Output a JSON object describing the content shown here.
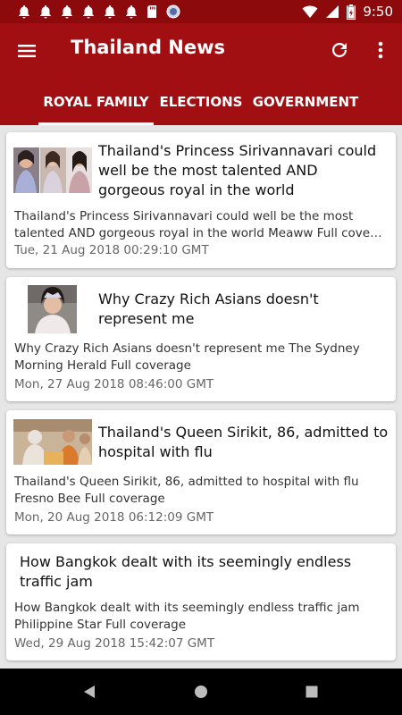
{
  "status_bar": {
    "time": "9:50",
    "notification_icons": [
      "bell-icon",
      "bell-icon",
      "bell-icon",
      "bell-icon",
      "bell-icon",
      "bell-icon",
      "sd-card-icon",
      "circle-icon"
    ]
  },
  "app_bar": {
    "title": "Thailand News",
    "background_color": "#a20f13"
  },
  "tabs": [
    {
      "label": "ROYAL FAMILY",
      "selected": true
    },
    {
      "label": "ELECTIONS",
      "selected": false
    },
    {
      "label": "GOVERNMENT",
      "selected": false
    }
  ],
  "articles": [
    {
      "headline": "Thailand's Princess Sirivannavari could well be the most talented AND gorgeous royal in the world",
      "summary_line1": "Thailand's Princess Sirivannavari could well be the most",
      "summary_line2": "talented AND gorgeous royal in the world  Meaww  Full cove…",
      "date": "Tue, 21 Aug 2018 00:29:10 GMT",
      "has_image": true
    },
    {
      "headline": "Why Crazy Rich Asians doesn't represent me",
      "summary_line1": "Why Crazy Rich Asians doesn't represent me  The Sydney",
      "summary_line2": "Morning Herald  Full coverage",
      "date": "Mon, 27 Aug 2018 08:46:00 GMT",
      "has_image": true
    },
    {
      "headline": "Thailand's Queen Sirikit, 86, admitted to hospital with flu",
      "summary_line1": "Thailand's Queen Sirikit, 86, admitted to hospital with flu",
      "summary_line2": "Fresno Bee  Full coverage",
      "date": "Mon, 20 Aug 2018 06:12:09 GMT",
      "has_image": true
    },
    {
      "headline": "How Bangkok dealt with its seemingly endless traffic jam",
      "summary_line1": "How Bangkok dealt with its seemingly endless traffic jam",
      "summary_line2": "Philippine Star  Full coverage",
      "date": "Wed, 29 Aug 2018 15:42:07 GMT",
      "has_image": false
    }
  ]
}
